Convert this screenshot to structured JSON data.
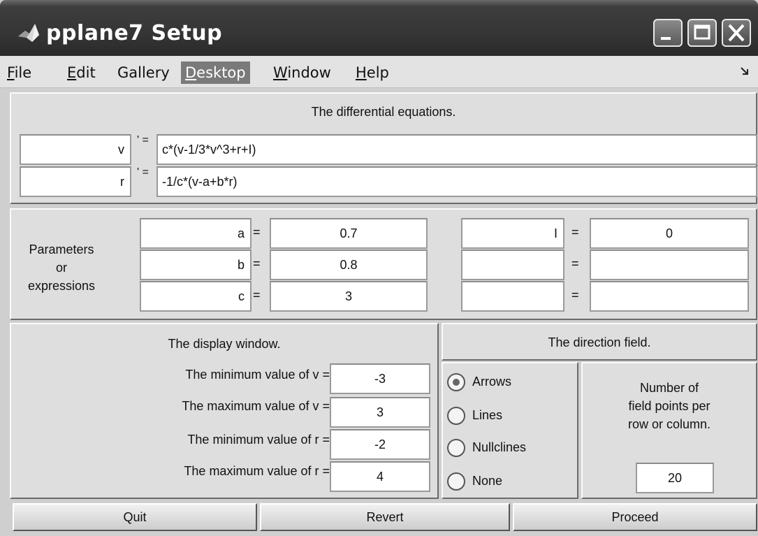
{
  "window": {
    "title": "pplane7 Setup"
  },
  "menu": {
    "items": [
      {
        "label": "File",
        "underline": "F",
        "rest": "ile"
      },
      {
        "label": "Edit",
        "underline": "E",
        "rest": "dit"
      },
      {
        "label": "Gallery"
      },
      {
        "label": "Desktop",
        "underline": "D",
        "rest": "esktop"
      },
      {
        "label": "Window",
        "underline": "W",
        "rest": "indow"
      },
      {
        "label": "Help",
        "underline": "H",
        "rest": "elp"
      }
    ],
    "active": "Desktop"
  },
  "equations": {
    "heading": "The differential equations.",
    "prime_symbol": "' =",
    "rows": [
      {
        "variable": "v",
        "expression": "c*(v-1/3*v^3+r+I)"
      },
      {
        "variable": "r",
        "expression": "-1/c*(v-a+b*r)"
      }
    ]
  },
  "parameters": {
    "label_line1": "Parameters",
    "label_line2": "or",
    "label_line3": "expressions",
    "equals": "=",
    "left": [
      {
        "name": "a",
        "value": "0.7"
      },
      {
        "name": "b",
        "value": "0.8"
      },
      {
        "name": "c",
        "value": "3"
      }
    ],
    "right": [
      {
        "name": "I",
        "value": "0"
      },
      {
        "name": "",
        "value": ""
      },
      {
        "name": "",
        "value": ""
      }
    ]
  },
  "display_window": {
    "heading": "The display window.",
    "rows": [
      {
        "label": "The minimum value of v =",
        "value": "-3"
      },
      {
        "label": "The maximum value of v =",
        "value": "3"
      },
      {
        "label": "The minimum value of r =",
        "value": "-2"
      },
      {
        "label": "The maximum value of r =",
        "value": "4"
      }
    ]
  },
  "direction_field": {
    "heading": "The direction field.",
    "options": [
      "Arrows",
      "Lines",
      "Nullclines",
      "None"
    ],
    "selected": "Arrows",
    "points_label_line1": "Number of",
    "points_label_line2": "field points per",
    "points_label_line3": "row or column.",
    "points_value": "20"
  },
  "buttons": {
    "quit": "Quit",
    "revert": "Revert",
    "proceed": "Proceed"
  }
}
